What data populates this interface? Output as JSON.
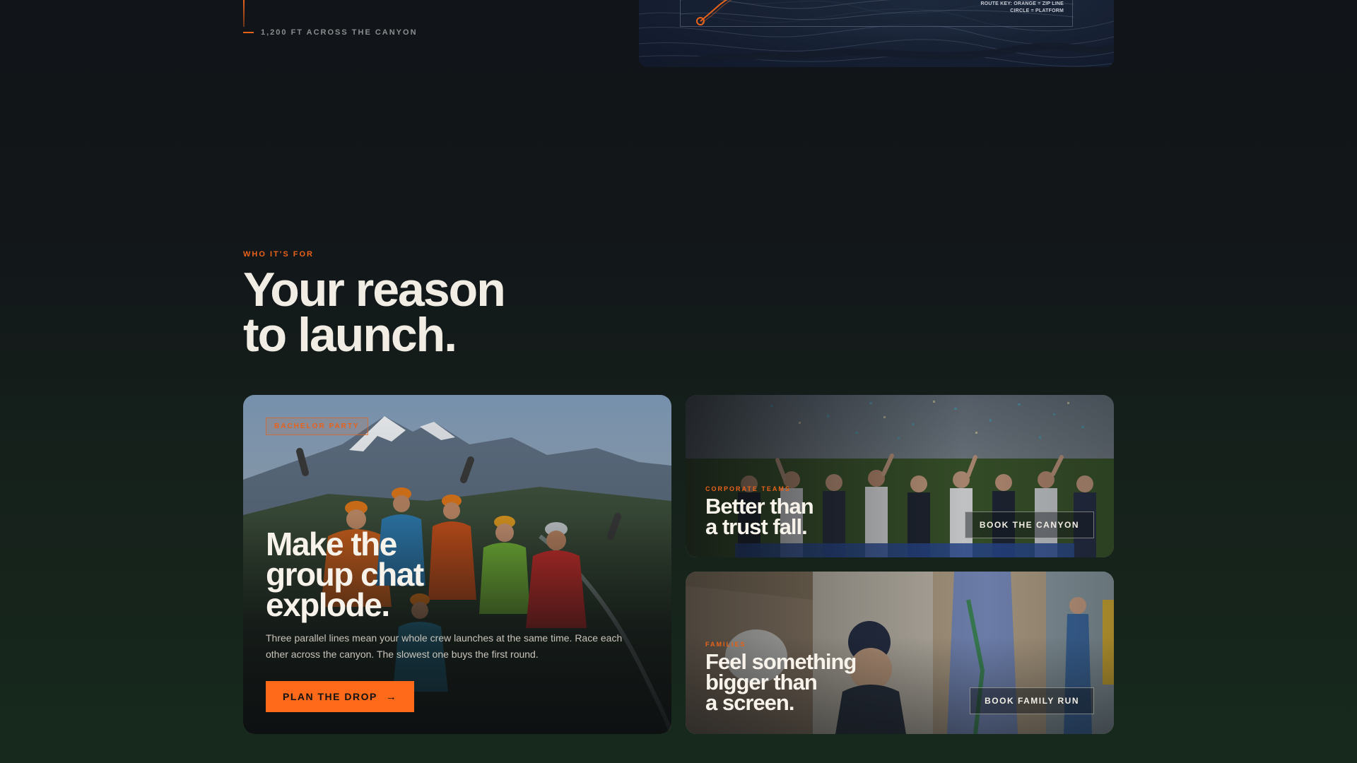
{
  "hero_fragment": {
    "distance_label": "1,200 FT ACROSS THE CANYON",
    "map": {
      "route_key_line1": "ROUTE KEY: ORANGE = ZIP LINE",
      "route_key_line2": "CIRCLE = PLATFORM",
      "route_color": "#e8621a"
    }
  },
  "section": {
    "eyebrow": "WHO IT'S FOR",
    "title_line1": "Your reason",
    "title_line2": "to launch."
  },
  "cards": {
    "bachelor": {
      "tag": "BACHELOR PARTY",
      "title_line1": "Make the",
      "title_line2": "group chat",
      "title_line3": "explode.",
      "description": "Three parallel lines mean your whole crew launches at the same time. Race each other across the canyon. The slowest one buys the first round.",
      "cta_label": "PLAN THE DROP",
      "cta_icon": "arrow-right-icon"
    },
    "corporate": {
      "tag": "CORPORATE TEAMS",
      "title_line1": "Better than",
      "title_line2": "a trust fall.",
      "button_label": "BOOK THE CANYON"
    },
    "families": {
      "tag": "FAMILIES",
      "title_line1": "Feel something",
      "title_line2": "bigger than",
      "title_line3": "a screen.",
      "button_label": "BOOK FAMILY RUN"
    }
  },
  "colors": {
    "accent": "#ff6a1a",
    "eyebrow": "#e8621a",
    "background_top": "#111418",
    "background_bottom": "#17291c",
    "text_primary": "#f2ede4"
  }
}
